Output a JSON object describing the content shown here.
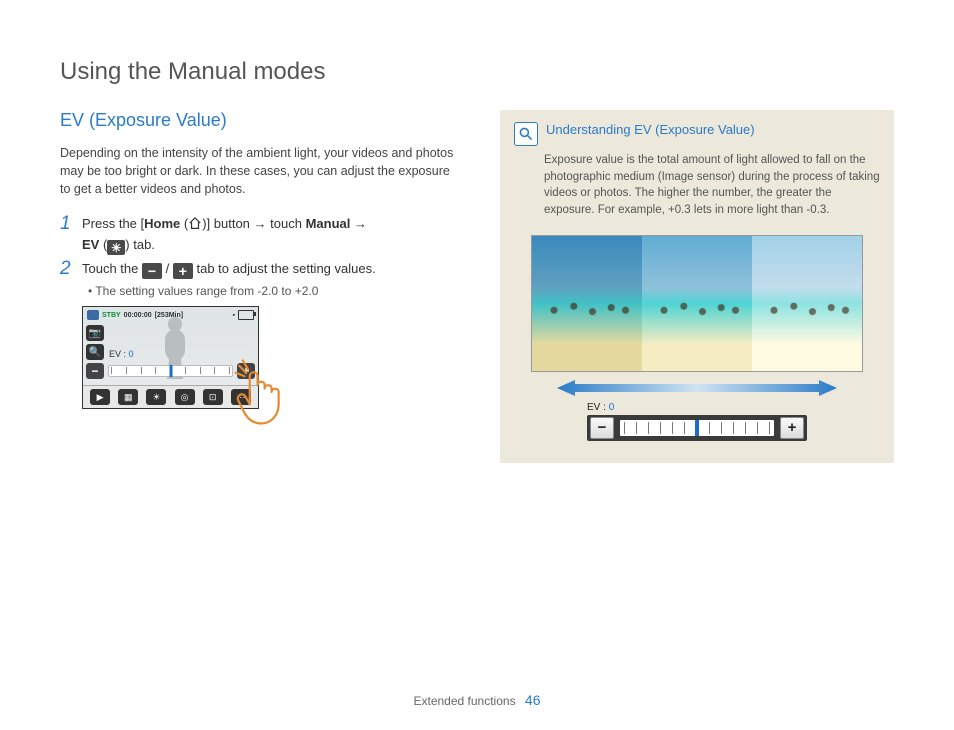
{
  "page_title": "Using the Manual modes",
  "section_title": "EV (Exposure Value)",
  "intro": "Depending on the intensity of the ambient light, your videos and photos may be too bright or dark. In these cases, you can adjust the exposure to get a better videos and photos.",
  "steps": [
    {
      "num": "1",
      "parts": {
        "a": "Press the [",
        "b": "Home",
        "c": " (",
        "d": ")] button ",
        "arrow1": "→",
        "e": " touch ",
        "f": "Manual",
        "arrow2": " → ",
        "g": "EV",
        "h": " (",
        "i": ") tab."
      }
    },
    {
      "num": "2",
      "parts": {
        "a": "Touch the ",
        "b": " / ",
        "c": " tab to adjust the setting values."
      },
      "bullet": "The setting values range from -2.0 to +2.0"
    }
  ],
  "camera": {
    "stby": "STBY",
    "time": "00:00:00",
    "remain": "[253Min]",
    "ev_label": "EV :",
    "ev_value": "0"
  },
  "info": {
    "title": "Understanding EV (Exposure Value)",
    "text": "Exposure value is the total amount of light allowed to fall on the photographic medium (Image sensor) during the process of taking videos or photos. The higher the number, the greater the exposure. For example, +0.3 lets in more light than -0.3.",
    "ev_label": "EV :",
    "ev_value": "0"
  },
  "footer": {
    "section": "Extended functions",
    "page": "46"
  }
}
